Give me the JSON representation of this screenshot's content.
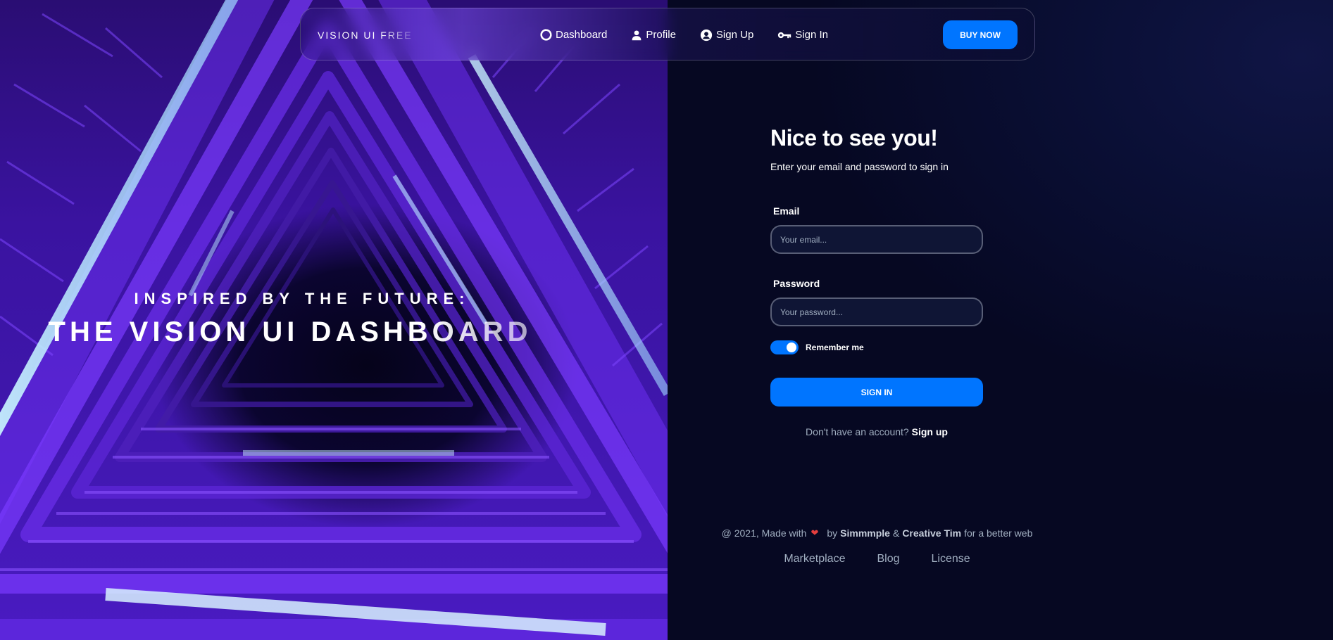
{
  "hero": {
    "subtitle": "INSPIRED BY THE FUTURE:",
    "title": "THE VISION UI DASHBOARD"
  },
  "navbar": {
    "brand": "VISION UI FREE",
    "links": [
      {
        "label": "Dashboard",
        "icon": "dashboard-icon"
      },
      {
        "label": "Profile",
        "icon": "person-icon"
      },
      {
        "label": "Sign Up",
        "icon": "user-circle-icon"
      },
      {
        "label": "Sign In",
        "icon": "key-icon"
      }
    ],
    "buy_label": "BUY NOW"
  },
  "form": {
    "title": "Nice to see you!",
    "description": "Enter your email and password to sign in",
    "email_label": "Email",
    "email_placeholder": "Your email...",
    "password_label": "Password",
    "password_placeholder": "Your password...",
    "remember_label": "Remember me",
    "remember_on": true,
    "submit_label": "SIGN IN",
    "no_account_text": "Don't have an account?",
    "signup_link": "Sign up"
  },
  "footer": {
    "prefix": "@ 2021, Made with",
    "by": "by",
    "author1": "Simmmple",
    "amp": "&",
    "author2": "Creative Tim",
    "suffix": "for a better web",
    "links": [
      "Marketplace",
      "Blog",
      "License"
    ]
  },
  "colors": {
    "accent": "#0075ff",
    "background": "#070a24",
    "hero_purple": "#4a1bc2"
  }
}
